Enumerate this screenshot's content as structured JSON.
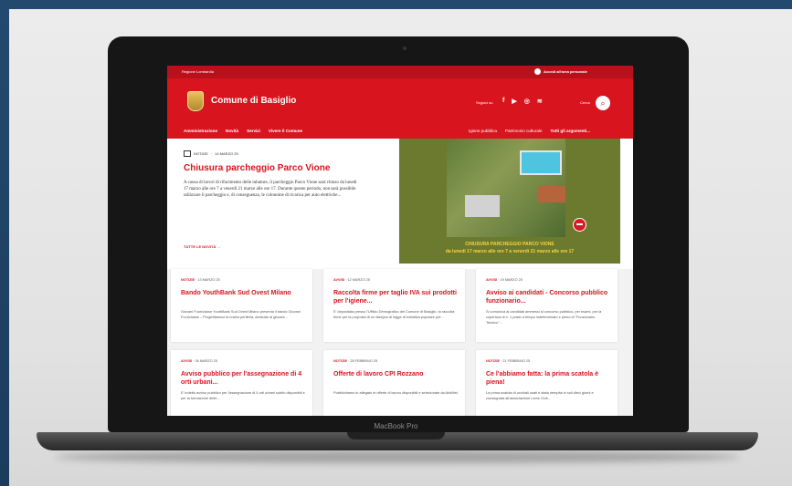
{
  "device": {
    "label": "MacBook Pro"
  },
  "site": {
    "region": "Regione Lombardia",
    "access_label": "Accedi all'area personale",
    "name": "Comune di Basiglio",
    "social_label": "Seguici su",
    "social_icons": [
      "facebook-icon",
      "youtube-icon",
      "instagram-icon",
      "rss-icon"
    ],
    "search_label": "Cerca",
    "nav": [
      "Amministrazione",
      "Novità",
      "Servizi",
      "Vivere il Comune"
    ],
    "topics": [
      "Igiene pubblica",
      "Patrimonio culturale"
    ],
    "all_topics": "Tutti gli argomenti...",
    "accent": "#d8141f"
  },
  "hero": {
    "category": "NOTIZIE",
    "date": "14 MARZO 25",
    "title": "Chiusura parcheggio Parco Vione",
    "text": "A causa di lavori di rifacimento delle tubature, il parcheggio Parco Vione sarà chiuso da lunedì 17 marzo alle ore 7 a venerdì 21 marzo alle ore 17. Durante questo periodo, non sarà possibile utilizzare il parcheggio e, di conseguenza, le colonnine di ricarica per auto elettriche...",
    "more": "TUTTE LE NOVITÀ",
    "image_caption_1": "CHIUSURA PARCHEGGIO PARCO VIONE",
    "image_caption_2": "da lunedì 17 marzo alle ore 7 a venerdì 21 marzo alle ore 17"
  },
  "cards": [
    {
      "category": "NOTIZIE",
      "date": "13 MARZO 25",
      "title": "Bando YouthBank Sud Ovest Milano",
      "text": "Giovani Fuoriclasse YouthBank Sud Ovest Milano presenta il bando Giovani Fuoriclasse – Progettiamoci la nostra periferia, dedicato ai giovani..."
    },
    {
      "category": "AVVISI",
      "date": "12 MARZO 25",
      "title": "Raccolta firme per taglio IVA sui prodotti per l'igiene...",
      "text": "E' depositata presso l'Ufficio Demografico del Comune di Basiglio, la raccolta firme per la proposta di un disegno di legge di iniziativa popolare per..."
    },
    {
      "category": "AVVISI",
      "date": "19 MARZO 25",
      "title": "Avviso ai candidati - Concorso pubblico funzionario...",
      "text": "Si comunica ai candidati ammessi al concorso pubblico, per esami, per la copertura di n. 1 posto a tempo indeterminato e pieno di \"Funzionario Tecnico\"..."
    },
    {
      "category": "AVVISI",
      "date": "06 MARZO 25",
      "title": "Avviso pubblico per l'assegnazione di 4 orti urbani...",
      "text": "E' indetto avviso pubblico per l'assegnazione di 4 orti urbani subito disponibili e per la formazione delle..."
    },
    {
      "category": "NOTIZIE",
      "date": "28 FEBBRAIO 25",
      "title": "Offerte di lavoro CPI Rozzano",
      "text": "Pubblichiamo in allegato le offerte di lavoro disponibili e selezionate da AfolMet."
    },
    {
      "category": "NOTIZIE",
      "date": "21 FEBBRAIO 25",
      "title": "Ce l'abbiamo fatta: la prima scatola è piena!",
      "text": "La prima scatola di occhiali usati è stata riempita in soli dieci giorni e consegnata all'associazione Lions Club..."
    }
  ]
}
